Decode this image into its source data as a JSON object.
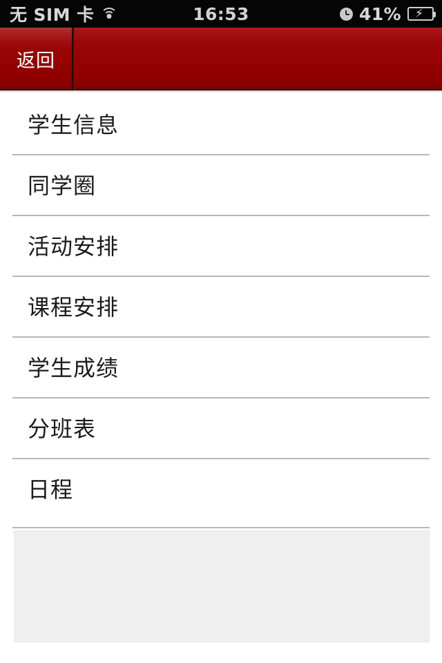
{
  "status_bar": {
    "carrier": "无 SIM 卡",
    "wifi_icon": "wifi-icon",
    "time": "16:53",
    "alarm_icon": "clock-icon",
    "battery_percent": "41%",
    "battery_icon": "battery-charging-icon",
    "background_color": "#050505",
    "text_color": "#d8d8d8"
  },
  "navbar": {
    "back_label": "返回",
    "title": "",
    "accent_color": "#9c0606",
    "text_color": "#ffffff"
  },
  "list": {
    "items": [
      {
        "label": "学生信息"
      },
      {
        "label": "同学圈"
      },
      {
        "label": "活动安排"
      },
      {
        "label": "课程安排"
      },
      {
        "label": "学生成绩"
      },
      {
        "label": "分班表"
      },
      {
        "label": "日程"
      }
    ],
    "divider_color": "#b6b6b6",
    "text_color": "#1b1b1b"
  },
  "bottom_panel": {
    "background_color": "#efefef"
  }
}
